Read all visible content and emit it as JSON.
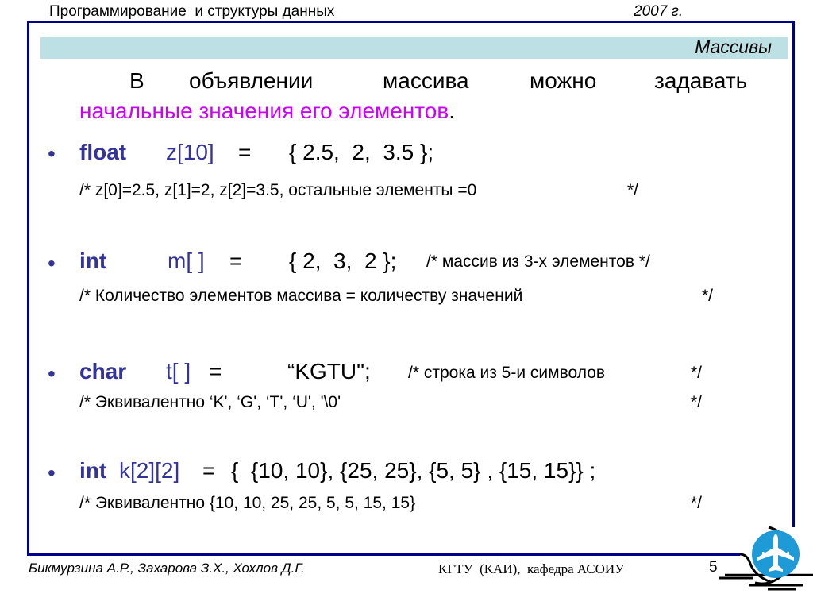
{
  "header": {
    "course": "Программирование  и структуры данных",
    "year": "2007 г."
  },
  "slide": {
    "title": "Массивы",
    "intro": {
      "line1_words": [
        "В",
        "объявлении",
        "массива",
        "можно",
        "задавать"
      ],
      "line2_highlight": "начальные значения его элементов",
      "line2_end": "."
    },
    "bullet_symbol": "•",
    "items": [
      {
        "keyword": "float",
        "declarator": "z[10]",
        "equals": "=",
        "initializer": "{ 2.5,  2,  3.5 };",
        "trailing_comment": "",
        "comment_lines": [
          {
            "text": "/* z[0]=2.5, z[1]=2, z[2]=3.5, остальные элементы =0",
            "close": "*/"
          }
        ]
      },
      {
        "keyword": "int",
        "declarator": "m[ ]",
        "equals": "=",
        "initializer": "{ 2,  3,  2 };",
        "trailing_comment": "/* массив из 3-х элементов */",
        "comment_lines": [
          {
            "text": "/* Количество элементов массива = количеству значений",
            "close": "*/"
          }
        ]
      },
      {
        "keyword": "char",
        "declarator": "t[ ]",
        "equals": "=",
        "initializer": "“KGTU\";",
        "trailing_comment": "/* строка из 5-и символов",
        "trailing_close": "*/",
        "comment_lines": [
          {
            "text": "/* Эквивалентно ‘K', ‘G', ‘T', ‘U', '\\0'",
            "close": "*/"
          }
        ]
      },
      {
        "keyword": "int",
        "declarator": "k[2][2]",
        "equals": "=",
        "initializer": "{  {10, 10}, {25, 25}, {5, 5} , {15, 15}} ;",
        "trailing_comment": "",
        "comment_lines": [
          {
            "text": "/* Эквивалентно {10, 10, 25, 25, 5, 5, 15, 15}",
            "close": "*/"
          }
        ]
      }
    ]
  },
  "footer": {
    "authors": "Бикмурзина А.Р., Захарова З.Х., Хохлов Д.Г.",
    "organization": "КГТУ  (КАИ),  кафедра АСОИУ",
    "page_number": "5"
  },
  "logo": {
    "icon": "airplane-icon",
    "circle_color": "#1e9ad6"
  },
  "colors": {
    "frame": "#00008b",
    "title_bar": "#bde0e4",
    "keyword": "#333399",
    "highlight": "#cc00ff"
  }
}
